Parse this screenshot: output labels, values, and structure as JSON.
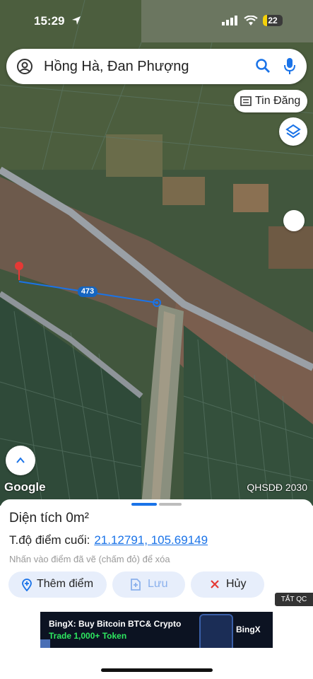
{
  "status_bar": {
    "time": "15:29",
    "battery": "22",
    "battery_color": "#f5d20a"
  },
  "search": {
    "query": "Hồng Hà, Đan Phượng"
  },
  "map": {
    "tin_dang_label": "Tin Đăng",
    "road_number": "473",
    "google_logo": "Google",
    "layer_name": "QHSDĐ 2030",
    "road_color": "#9aa0a6",
    "measure_line_color": "#1a73e8",
    "marker_color": "#e53935"
  },
  "panel": {
    "area_label": "Diện tích",
    "area_value": "0m²",
    "endpoint_label": "T.độ điểm cuối:",
    "endpoint_value": "21.12791, 105.69149",
    "hint": "Nhấn vào điểm đã vẽ (chấm đỏ) để xóa",
    "buttons": {
      "add_point": "Thêm điểm",
      "save": "Lưu",
      "cancel": "Hủy"
    },
    "accent_color": "#1a73e8"
  },
  "ad": {
    "close_label": "TẮT QC",
    "line1": "BingX: Buy Bitcoin BTC& Crypto",
    "line2": "Trade 1,000+ Token",
    "brand": "BingX"
  }
}
